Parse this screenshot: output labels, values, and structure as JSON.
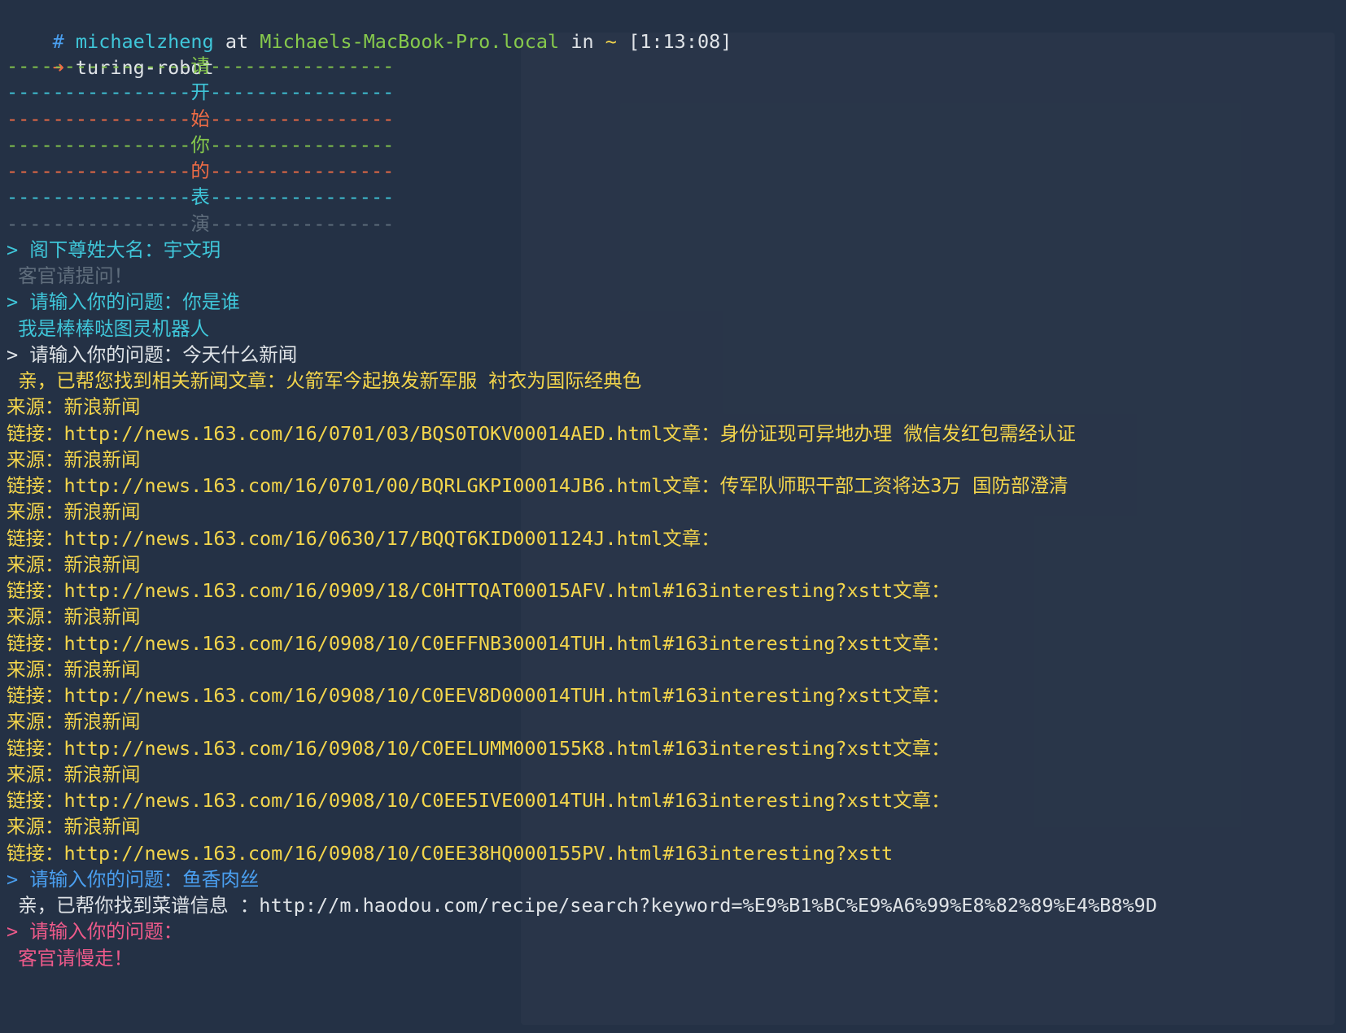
{
  "colors": {
    "background": "#243145",
    "green": "#86c94c",
    "cyan": "#3fc6d9",
    "orange": "#ef6c45",
    "yellow": "#f3d54c",
    "blue": "#4a9ff0",
    "pink": "#ee5a8a",
    "gray": "#7f8a97"
  },
  "prompt": {
    "hash": "#",
    "user": "michaelzheng",
    "at": "at",
    "host": "Michaels-MacBook-Pro.local",
    "in": "in",
    "dir": "~",
    "time": "[1:13:08]",
    "arrow": "➜",
    "command": "turing-robot"
  },
  "banner": {
    "dash": "----------------",
    "chars": [
      "请",
      "开",
      "始",
      "你",
      "的",
      "表",
      "演"
    ]
  },
  "session": {
    "name_prompt": "> 阁下尊姓大名：",
    "name_value": "宇文玥",
    "greeting": " 客官请提问！",
    "q1_prompt": "> 请输入你的问题：",
    "q1_value": "你是谁",
    "a1": " 我是棒棒哒图灵机器人",
    "q2_prompt": "> 请输入你的问题：",
    "q2_value": "今天什么新闻",
    "a2_intro": " 亲，已帮您找到相关新闻文章：火箭军今起换发新军服 衬衣为国际经典色",
    "source_label": "来源：",
    "source_value": "新浪新闻",
    "link_label": "链接：",
    "news": [
      {
        "url": "http://news.163.com/16/0701/03/BQS0TOKV00014AED.html",
        "next": "文章：身份证现可异地办理 微信发红包需经认证"
      },
      {
        "url": "http://news.163.com/16/0701/00/BQRLGKPI00014JB6.html",
        "next": "文章：传军队师职干部工资将达3万 国防部澄清"
      },
      {
        "url": "http://news.163.com/16/0630/17/BQQT6KID0001124J.html",
        "next": "文章："
      },
      {
        "url": "http://news.163.com/16/0909/18/C0HTTQAT00015AFV.html#163interesting?xstt",
        "next": "文章："
      },
      {
        "url": "http://news.163.com/16/0908/10/C0EFFNB300014TUH.html#163interesting?xstt",
        "next": "文章："
      },
      {
        "url": "http://news.163.com/16/0908/10/C0EEV8D000014TUH.html#163interesting?xstt",
        "next": "文章："
      },
      {
        "url": "http://news.163.com/16/0908/10/C0EELUMM000155K8.html#163interesting?xstt",
        "next": "文章："
      },
      {
        "url": "http://news.163.com/16/0908/10/C0EE5IVE00014TUH.html#163interesting?xstt",
        "next": "文章："
      },
      {
        "url": "http://news.163.com/16/0908/10/C0EE38HQ000155PV.html#163interesting?xstt",
        "next": ""
      }
    ],
    "q3_prompt": "> 请输入你的问题：",
    "q3_value": "鱼香肉丝",
    "a3": " 亲，已帮你找到菜谱信息 ：http://m.haodou.com/recipe/search?keyword=%E9%B1%BC%E9%A6%99%E8%82%89%E4%B8%9D",
    "q4_prompt": "> 请输入你的问题：",
    "farewell": " 客官请慢走！"
  }
}
